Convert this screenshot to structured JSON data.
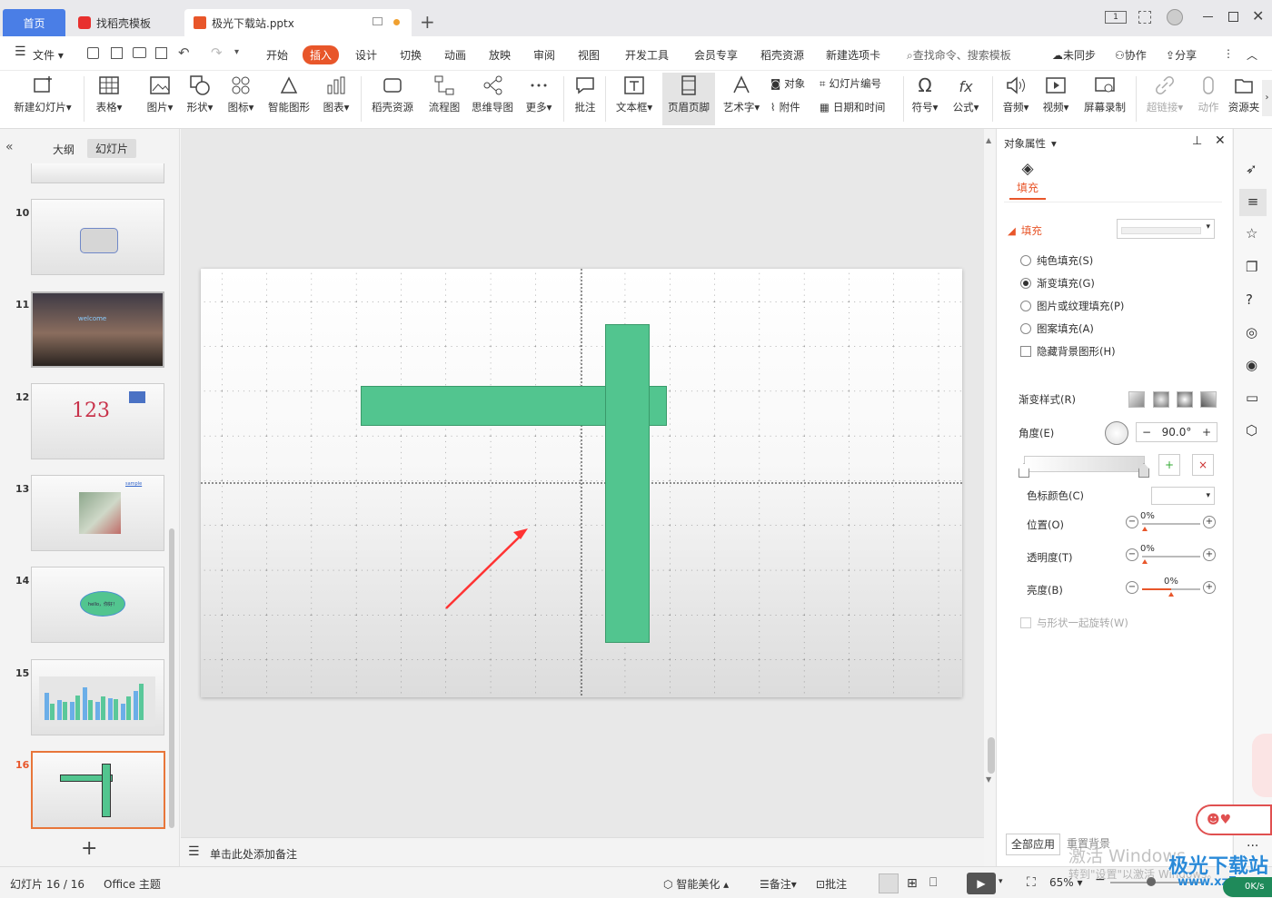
{
  "tabs": {
    "home": "首页",
    "template": "找稻壳模板",
    "file": "极光下载站.pptx"
  },
  "window": {
    "page_indicator": "1"
  },
  "menu": {
    "file": "文件",
    "items": [
      "开始",
      "插入",
      "设计",
      "切换",
      "动画",
      "放映",
      "审阅",
      "视图",
      "开发工具",
      "会员专享",
      "稻壳资源",
      "新建选项卡"
    ],
    "search_placeholder": "查找命令、搜索模板",
    "sync": "未同步",
    "collab": "协作",
    "share": "分享"
  },
  "ribbon": {
    "new_slide": "新建幻灯片",
    "table": "表格",
    "picture": "图片",
    "shape": "形状",
    "icon": "图标",
    "smart_shape": "智能图形",
    "chart": "图表",
    "docer_res": "稻壳资源",
    "flowchart": "流程图",
    "mindmap": "思维导图",
    "more": "更多",
    "comment": "批注",
    "textbox": "文本框",
    "header_footer": "页眉页脚",
    "wordart": "艺术字",
    "object": "对象",
    "slide_number": "幻灯片编号",
    "attachment": "附件",
    "datetime": "日期和时间",
    "symbol": "符号",
    "formula": "公式",
    "audio": "音频",
    "video": "视频",
    "screen_record": "屏幕录制",
    "hyperlink": "超链接",
    "action": "动作",
    "resource": "资源夹"
  },
  "left_panel": {
    "outline": "大纲",
    "slides": "幻灯片",
    "thumbs": [
      {
        "num": "10"
      },
      {
        "num": "11",
        "text": "welcome"
      },
      {
        "num": "12",
        "text": "123"
      },
      {
        "num": "13",
        "text": "sample"
      },
      {
        "num": "14",
        "text": "hello，你好！"
      },
      {
        "num": "15"
      },
      {
        "num": "16"
      }
    ]
  },
  "notes": {
    "placeholder": "单击此处添加备注"
  },
  "right_panel": {
    "title": "对象属性",
    "tab_fill": "填充",
    "section_fill": "填充",
    "solid": "纯色填充(S)",
    "gradient": "渐变填充(G)",
    "picture_texture": "图片或纹理填充(P)",
    "pattern": "图案填充(A)",
    "hide_bg": "隐藏背景图形(H)",
    "gradient_style": "渐变样式(R)",
    "angle_label": "角度(E)",
    "angle_value": "90.0°",
    "stop_color": "色标颜色(C)",
    "position": "位置(O)",
    "position_value": "0%",
    "transparency": "透明度(T)",
    "transparency_value": "0%",
    "brightness": "亮度(B)",
    "brightness_value": "0%",
    "rotate_with_shape": "与形状一起旋转(W)",
    "apply_all": "全部应用",
    "reset_bg": "重置背景"
  },
  "status": {
    "slide_info": "幻灯片 16 / 16",
    "theme": "Office 主题",
    "beautify": "智能美化",
    "notes": "备注",
    "comment": "批注",
    "zoom": "65%"
  },
  "watermark": {
    "activate": "激活 Windows",
    "activate_sub": "转到\"设置\"以激活 Windows。",
    "site": "极光下载站",
    "site_url": "www.xz7.com",
    "speed": "0K/s"
  },
  "colors": {
    "accent": "#e8562a",
    "shape_green": "#52c58f",
    "arrow_red": "#ff3333"
  }
}
